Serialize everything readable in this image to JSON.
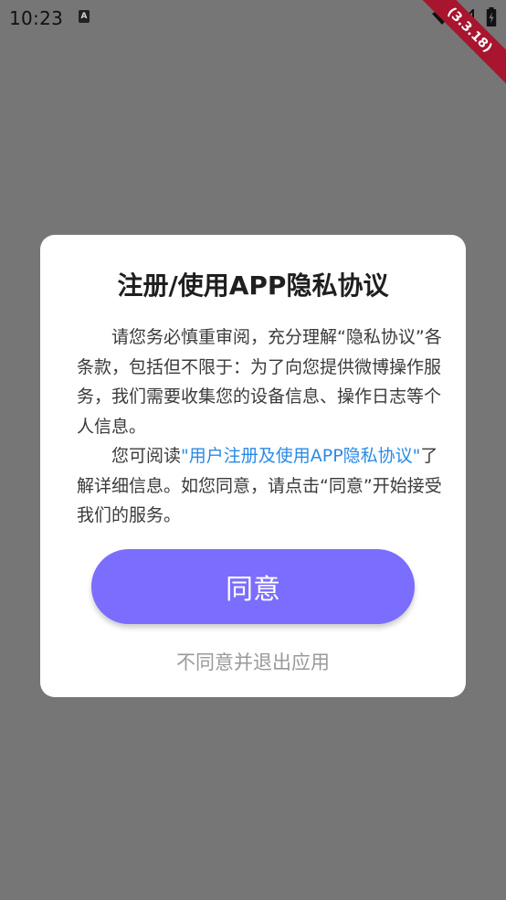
{
  "status_bar": {
    "time": "10:23",
    "notification_icon_glyph": "A",
    "icons": [
      "wifi-icon",
      "signal-icon",
      "battery-icon"
    ]
  },
  "debug_ribbon": {
    "label": "(3.3.18)",
    "color": "#a8152f"
  },
  "dialog": {
    "title": "注册/使用APP隐私协议",
    "paragraph1": "请您务必慎重审阅，充分理解“隐私协议”各条款，包括但不限于：为了向您提供微博操作服务，我们需要收集您的设备信息、操作日志等个人信息。",
    "paragraph2_prefix": "您可阅读",
    "paragraph2_link": "\"用户注册及使用APP隐私协议\"",
    "paragraph2_suffix": "了解详细信息。如您同意，请点击“同意”开始接受我们的服务。",
    "agree_label": "同意",
    "disagree_label": "不同意并退出应用"
  },
  "colors": {
    "overlay": "#767676",
    "accent_button": "#7b6dfd",
    "link": "#2b8ae6",
    "disagree_text": "#9a9a9a"
  }
}
